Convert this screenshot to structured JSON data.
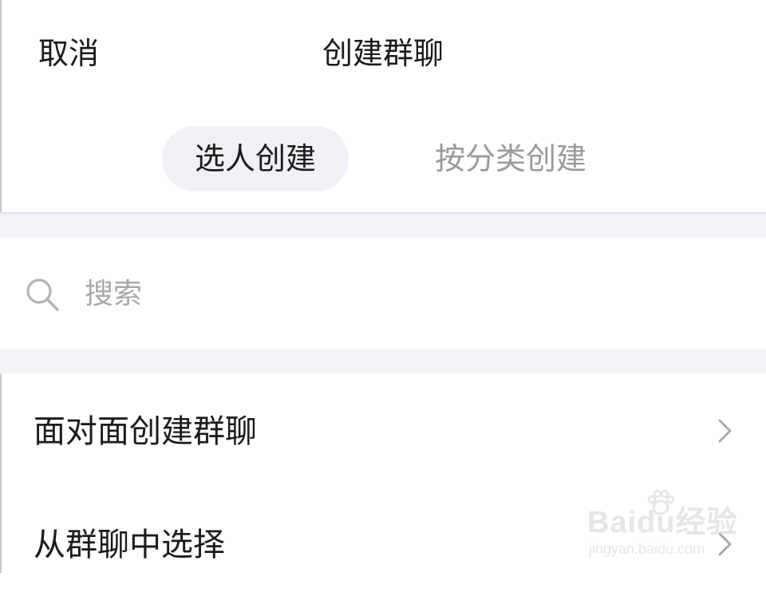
{
  "header": {
    "cancel_label": "取消",
    "title": "创建群聊"
  },
  "segmented": {
    "tabs": [
      {
        "label": "选人创建",
        "active": true
      },
      {
        "label": "按分类创建",
        "active": false
      }
    ]
  },
  "search": {
    "icon": "search-icon",
    "placeholder": "搜索"
  },
  "list": {
    "items": [
      {
        "label": "面对面创建群聊",
        "icon": "chevron-right-icon"
      },
      {
        "label": "从群聊中选择",
        "icon": "chevron-right-icon"
      }
    ]
  },
  "watermark": {
    "brand": "Baidu经验",
    "url": "jingyan.baidu.com"
  },
  "colors": {
    "text": "#1b1b1b",
    "muted": "#9a9a9a",
    "active_tab_bg": "#f0f1f5",
    "gap_bg": "#f2f3f7"
  }
}
